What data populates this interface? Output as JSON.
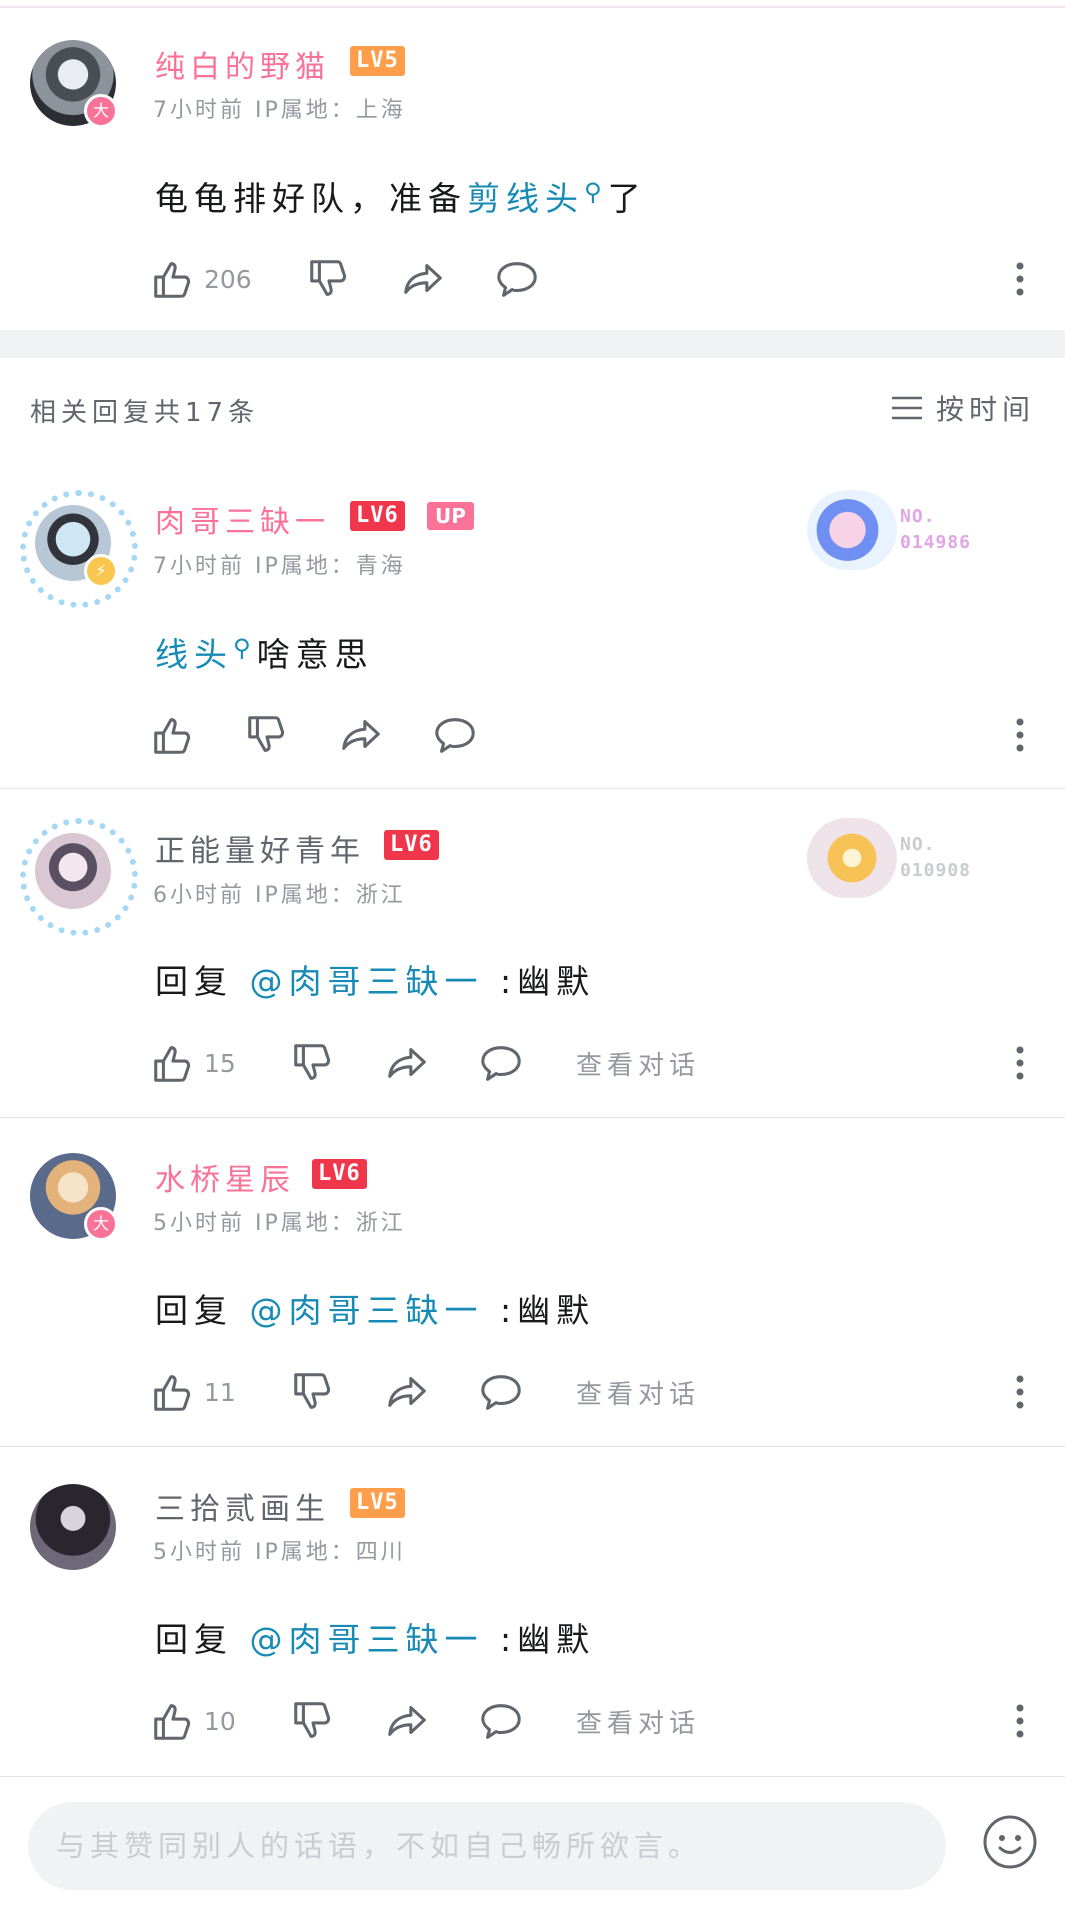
{
  "colors": {
    "pink": "#fb7299",
    "link": "#178bb5",
    "muted": "#9499a0",
    "lv5": "#ff9e4a",
    "lv6": "#f0364b"
  },
  "main_comment": {
    "username": "纯白的野猫",
    "level": "LV5",
    "meta": "7小时前  IP属地：上海",
    "text_before": "龟龟排好队，准备",
    "link": "剪线头",
    "text_after": "了",
    "likes": "206"
  },
  "reply_header": {
    "count_text": "相关回复共17条",
    "sort_label": "按时间"
  },
  "replies": [
    {
      "username": "肉哥三缺一",
      "level": "LV6",
      "up_tag": "UP",
      "meta": "7小时前  IP属地：青海",
      "link": "线头",
      "text": "啥意思",
      "fan_no_label": "NO.",
      "fan_no": "014986"
    },
    {
      "username": "正能量好青年",
      "level": "LV6",
      "meta": "6小时前  IP属地：浙江",
      "reply_prefix": "回复 ",
      "mention": "@肉哥三缺一",
      "text": " :幽默",
      "likes": "15",
      "view_dialog": "查看对话",
      "fan_no_label": "NO.",
      "fan_no": "010908"
    },
    {
      "username": "水桥星辰",
      "level": "LV6",
      "meta": "5小时前  IP属地：浙江",
      "reply_prefix": "回复 ",
      "mention": "@肉哥三缺一",
      "text": " :幽默",
      "likes": "11",
      "view_dialog": "查看对话"
    },
    {
      "username": "三拾贰画生",
      "level": "LV5",
      "meta": "5小时前  IP属地：四川",
      "reply_prefix": "回复 ",
      "mention": "@肉哥三缺一",
      "text": " :幽默",
      "likes": "10",
      "view_dialog": "查看对话"
    }
  ],
  "bottom_bar": {
    "placeholder": "与其赞同别人的话语，不如自己畅所欲言。"
  },
  "icons": [
    "like-icon",
    "dislike-icon",
    "share-icon",
    "reply-icon",
    "more-icon",
    "search-icon",
    "sort-icon",
    "emoji-icon"
  ]
}
